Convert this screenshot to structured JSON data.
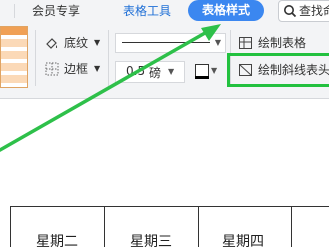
{
  "tabs": {
    "fragment": "",
    "vip": "会员专享",
    "table_tools": "表格工具",
    "table_style": "表格样式"
  },
  "search": {
    "label": "查找命"
  },
  "ribbon": {
    "shading": "底纹",
    "border": "边框",
    "line_width_value": "0.5",
    "line_width_unit": "磅",
    "draw_table": "绘制表格",
    "draw_diagonal_header": "绘制斜线表头"
  },
  "table": {
    "headers": [
      "星期二",
      "星期三",
      "星期四"
    ]
  },
  "colors": {
    "accent": "#3b87f0",
    "tab_active_text": "#ffffff",
    "tab_tools_text": "#1f6fd6",
    "highlight": "#22c13f",
    "arrow": "#2ec04a"
  },
  "icons": [
    "search-icon",
    "shading-icon",
    "border-icon",
    "dropdown-arrow-icon",
    "pen-color-icon",
    "draw-table-icon",
    "diagonal-header-icon"
  ]
}
